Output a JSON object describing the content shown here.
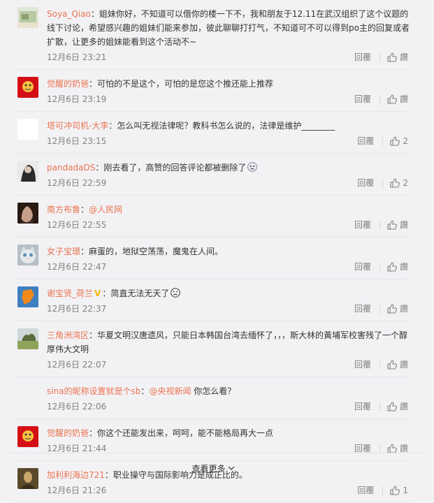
{
  "comments": [
    {
      "user": "Soya_Qiao",
      "sep": "：",
      "text": "姐妹你好，不知道可以借你的楼一下不，我和朋友于12.11在武汉组织了这个议题的线下讨论，希望感兴趣的姐妹们能来参加，彼此聊聊打打气，不知道可不可以得到po主的回复或者扩散，让更多的姐妹能看到这个活动不~",
      "time": "12月6日 23:21",
      "reply": "回覆",
      "like": "讚"
    },
    {
      "user": "觉醒的奶爸",
      "sep": "：",
      "text": "可怕的不是这个，可怕的是您这个推还能上推荐",
      "time": "12月6日 23:19",
      "reply": "回覆",
      "like": "讚"
    },
    {
      "user": "塔可冲司机-大李",
      "sep": "：",
      "text": "怎么叫无视法律呢？教科书怎么说的，法律是维护________",
      "time": "12月6日 23:15",
      "reply": "回覆",
      "like": "2"
    },
    {
      "user": "pandadaDS",
      "sep": "：",
      "text": "刚去看了，高赞的回答评论都被删除了",
      "time": "12月6日 22:59",
      "reply": "回覆",
      "like": "2"
    },
    {
      "user": "南方布鲁",
      "sep": "：",
      "mention": "@人民网",
      "text": "",
      "time": "12月6日 22:55",
      "reply": "回覆",
      "like": "讚"
    },
    {
      "user": "女子宝璟",
      "sep": "：",
      "text": "麻蛋的，地狱空荡荡，魔鬼在人间。",
      "time": "12月6日 22:47",
      "reply": "回覆",
      "like": "讚"
    },
    {
      "user": "谢宝贤_荷兰",
      "sep": "：",
      "text": "简直无法无天了",
      "time": "12月6日 22:37",
      "reply": "回覆",
      "like": "讚"
    },
    {
      "user": "三角洲湾区",
      "sep": "：",
      "text": "华夏文明汉唐遗风，只能日本韩国台湾去缅怀了，，，斯大林的黃埔军校害残了一个醇厚伟大文明",
      "time": "12月6日 22:07",
      "reply": "回覆",
      "like": "讚"
    },
    {
      "user": "sina的昵称设置就是个sb",
      "sep": "：",
      "mention": "@央视新闻",
      "text": " 你怎么看？",
      "time": "12月6日 22:06",
      "reply": "回覆",
      "like": "讚"
    },
    {
      "user": "觉醒的奶爸",
      "sep": "：",
      "text": "你这个还能发出来，呵呵，能不能格局再大一点",
      "time": "12月6日 21:44",
      "reply": "回覆",
      "like": "讚"
    },
    {
      "user": "加利利海边721",
      "sep": "：",
      "text": "职业操守与国际影响力是成正比的。",
      "time": "12月6日 21:26",
      "reply": "回覆",
      "like": "1"
    }
  ],
  "more_label": "查看更多",
  "colors": {
    "name": "#eb7350",
    "time": "#808080",
    "bg": "#f2f2f5"
  }
}
